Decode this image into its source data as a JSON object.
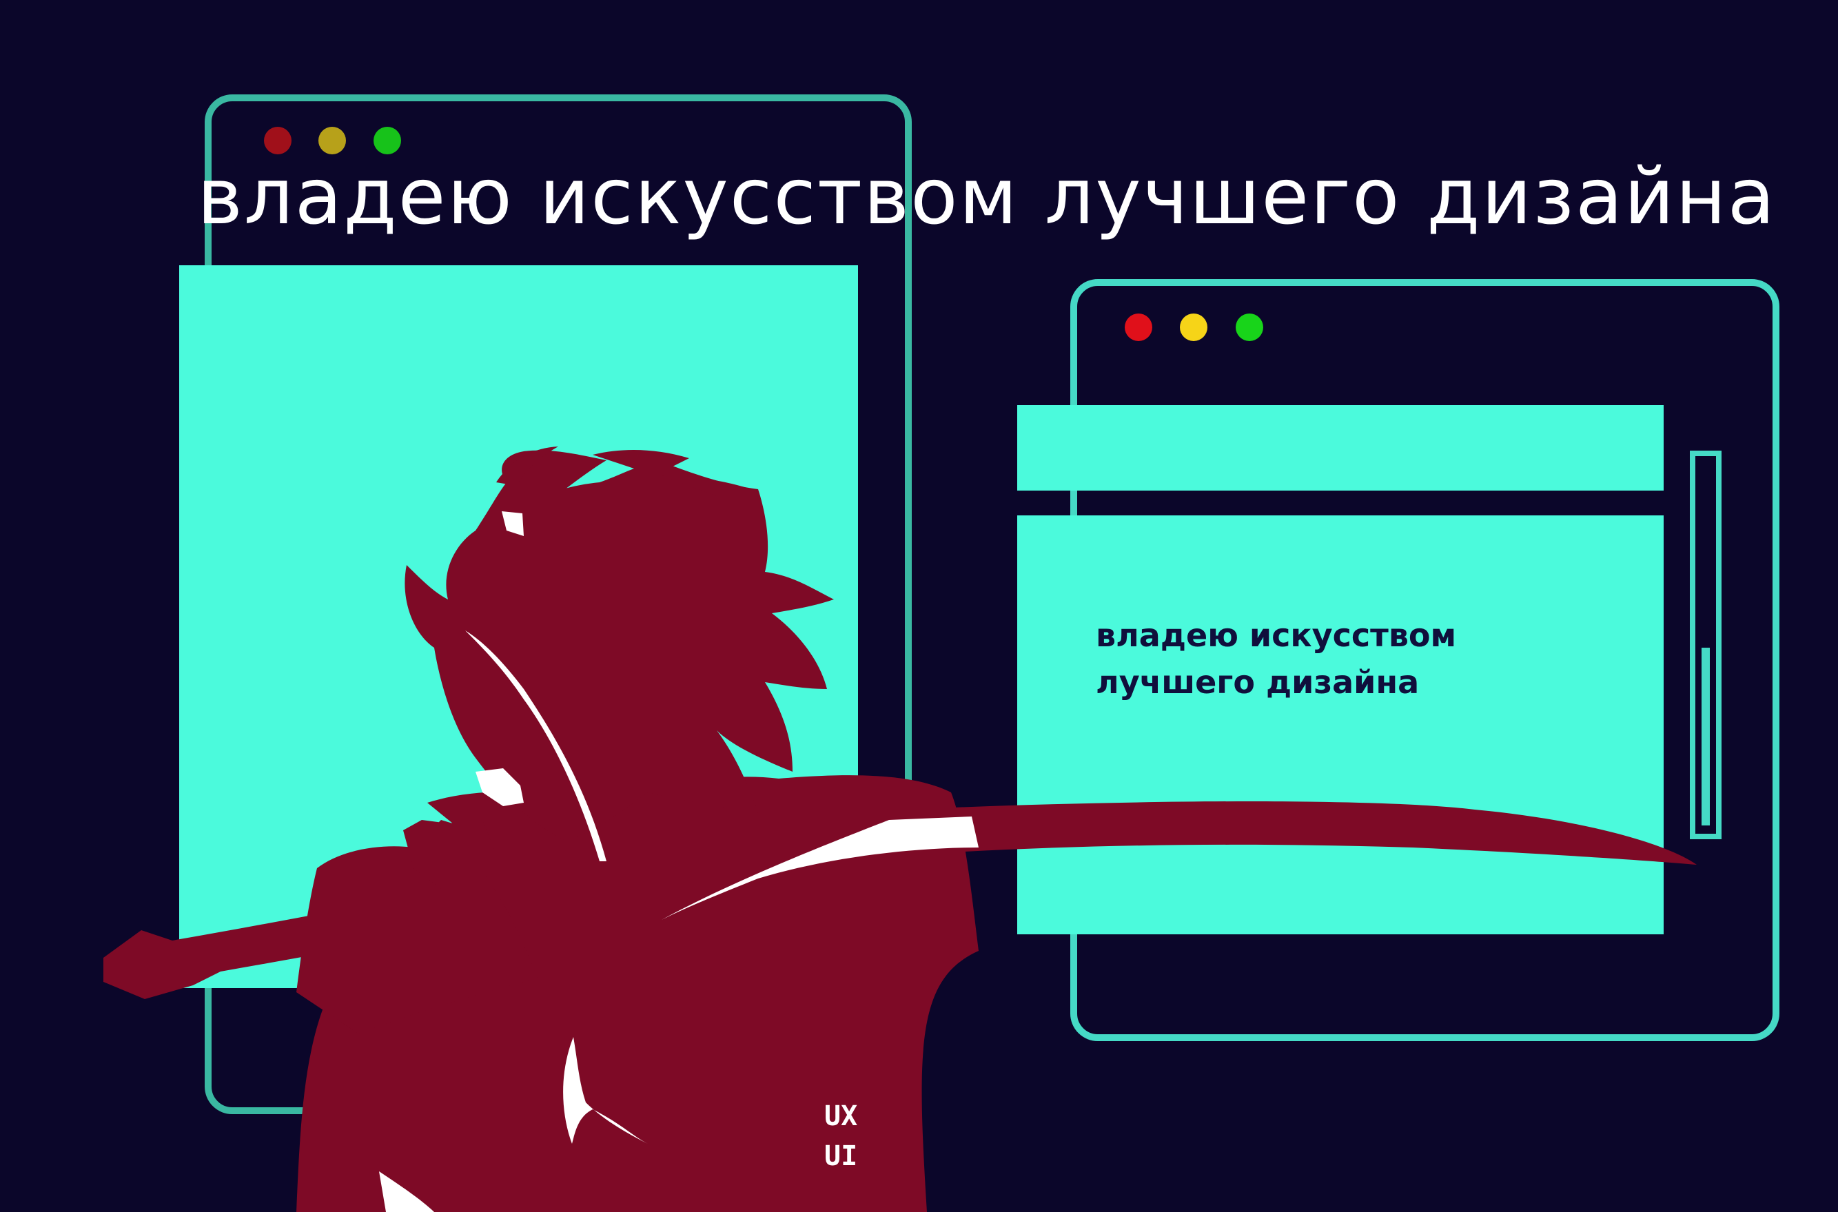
{
  "headline": "владею искусством лучшего дизайна",
  "panel_text": {
    "line1": "владею искусством",
    "line2": "лучшего дизайна"
  },
  "tag": {
    "line1": "UX",
    "line2": "UI"
  },
  "colors": {
    "background": "#0b062a",
    "frame_cyan": "#45dac6",
    "panel_cyan": "#4bfadc",
    "figure_maroon": "#7e0a26",
    "highlight_white": "#ffffff",
    "dot_red": "#e0101a",
    "dot_yellow": "#f6d418",
    "dot_green": "#18d41a",
    "dot_red_dim": "#a0101a",
    "dot_yellow_dim": "#b7a11a",
    "dot_green_dim": "#17c21a"
  },
  "icons": {
    "figure": "samurai-silhouette-with-sword",
    "traffic_lights": "window-control-dots"
  }
}
